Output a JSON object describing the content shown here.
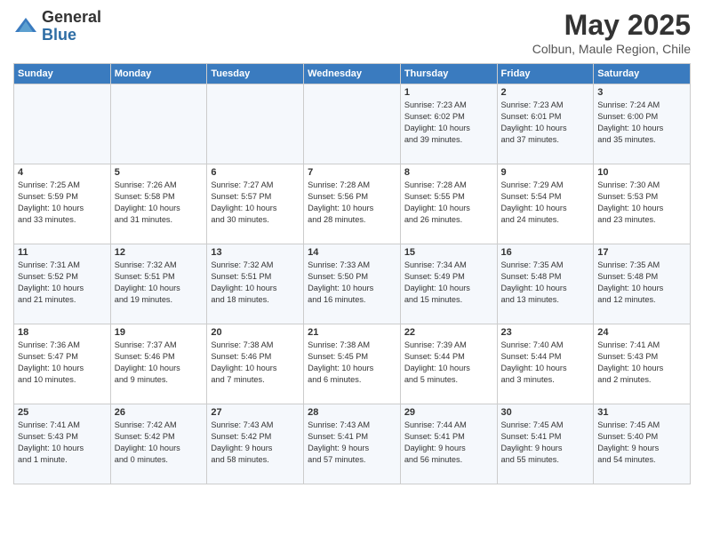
{
  "header": {
    "logo_general": "General",
    "logo_blue": "Blue",
    "month": "May 2025",
    "location": "Colbun, Maule Region, Chile"
  },
  "days_of_week": [
    "Sunday",
    "Monday",
    "Tuesday",
    "Wednesday",
    "Thursday",
    "Friday",
    "Saturday"
  ],
  "weeks": [
    [
      {
        "day": "",
        "info": ""
      },
      {
        "day": "",
        "info": ""
      },
      {
        "day": "",
        "info": ""
      },
      {
        "day": "",
        "info": ""
      },
      {
        "day": "1",
        "info": "Sunrise: 7:23 AM\nSunset: 6:02 PM\nDaylight: 10 hours\nand 39 minutes."
      },
      {
        "day": "2",
        "info": "Sunrise: 7:23 AM\nSunset: 6:01 PM\nDaylight: 10 hours\nand 37 minutes."
      },
      {
        "day": "3",
        "info": "Sunrise: 7:24 AM\nSunset: 6:00 PM\nDaylight: 10 hours\nand 35 minutes."
      }
    ],
    [
      {
        "day": "4",
        "info": "Sunrise: 7:25 AM\nSunset: 5:59 PM\nDaylight: 10 hours\nand 33 minutes."
      },
      {
        "day": "5",
        "info": "Sunrise: 7:26 AM\nSunset: 5:58 PM\nDaylight: 10 hours\nand 31 minutes."
      },
      {
        "day": "6",
        "info": "Sunrise: 7:27 AM\nSunset: 5:57 PM\nDaylight: 10 hours\nand 30 minutes."
      },
      {
        "day": "7",
        "info": "Sunrise: 7:28 AM\nSunset: 5:56 PM\nDaylight: 10 hours\nand 28 minutes."
      },
      {
        "day": "8",
        "info": "Sunrise: 7:28 AM\nSunset: 5:55 PM\nDaylight: 10 hours\nand 26 minutes."
      },
      {
        "day": "9",
        "info": "Sunrise: 7:29 AM\nSunset: 5:54 PM\nDaylight: 10 hours\nand 24 minutes."
      },
      {
        "day": "10",
        "info": "Sunrise: 7:30 AM\nSunset: 5:53 PM\nDaylight: 10 hours\nand 23 minutes."
      }
    ],
    [
      {
        "day": "11",
        "info": "Sunrise: 7:31 AM\nSunset: 5:52 PM\nDaylight: 10 hours\nand 21 minutes."
      },
      {
        "day": "12",
        "info": "Sunrise: 7:32 AM\nSunset: 5:51 PM\nDaylight: 10 hours\nand 19 minutes."
      },
      {
        "day": "13",
        "info": "Sunrise: 7:32 AM\nSunset: 5:51 PM\nDaylight: 10 hours\nand 18 minutes."
      },
      {
        "day": "14",
        "info": "Sunrise: 7:33 AM\nSunset: 5:50 PM\nDaylight: 10 hours\nand 16 minutes."
      },
      {
        "day": "15",
        "info": "Sunrise: 7:34 AM\nSunset: 5:49 PM\nDaylight: 10 hours\nand 15 minutes."
      },
      {
        "day": "16",
        "info": "Sunrise: 7:35 AM\nSunset: 5:48 PM\nDaylight: 10 hours\nand 13 minutes."
      },
      {
        "day": "17",
        "info": "Sunrise: 7:35 AM\nSunset: 5:48 PM\nDaylight: 10 hours\nand 12 minutes."
      }
    ],
    [
      {
        "day": "18",
        "info": "Sunrise: 7:36 AM\nSunset: 5:47 PM\nDaylight: 10 hours\nand 10 minutes."
      },
      {
        "day": "19",
        "info": "Sunrise: 7:37 AM\nSunset: 5:46 PM\nDaylight: 10 hours\nand 9 minutes."
      },
      {
        "day": "20",
        "info": "Sunrise: 7:38 AM\nSunset: 5:46 PM\nDaylight: 10 hours\nand 7 minutes."
      },
      {
        "day": "21",
        "info": "Sunrise: 7:38 AM\nSunset: 5:45 PM\nDaylight: 10 hours\nand 6 minutes."
      },
      {
        "day": "22",
        "info": "Sunrise: 7:39 AM\nSunset: 5:44 PM\nDaylight: 10 hours\nand 5 minutes."
      },
      {
        "day": "23",
        "info": "Sunrise: 7:40 AM\nSunset: 5:44 PM\nDaylight: 10 hours\nand 3 minutes."
      },
      {
        "day": "24",
        "info": "Sunrise: 7:41 AM\nSunset: 5:43 PM\nDaylight: 10 hours\nand 2 minutes."
      }
    ],
    [
      {
        "day": "25",
        "info": "Sunrise: 7:41 AM\nSunset: 5:43 PM\nDaylight: 10 hours\nand 1 minute."
      },
      {
        "day": "26",
        "info": "Sunrise: 7:42 AM\nSunset: 5:42 PM\nDaylight: 10 hours\nand 0 minutes."
      },
      {
        "day": "27",
        "info": "Sunrise: 7:43 AM\nSunset: 5:42 PM\nDaylight: 9 hours\nand 58 minutes."
      },
      {
        "day": "28",
        "info": "Sunrise: 7:43 AM\nSunset: 5:41 PM\nDaylight: 9 hours\nand 57 minutes."
      },
      {
        "day": "29",
        "info": "Sunrise: 7:44 AM\nSunset: 5:41 PM\nDaylight: 9 hours\nand 56 minutes."
      },
      {
        "day": "30",
        "info": "Sunrise: 7:45 AM\nSunset: 5:41 PM\nDaylight: 9 hours\nand 55 minutes."
      },
      {
        "day": "31",
        "info": "Sunrise: 7:45 AM\nSunset: 5:40 PM\nDaylight: 9 hours\nand 54 minutes."
      }
    ]
  ]
}
